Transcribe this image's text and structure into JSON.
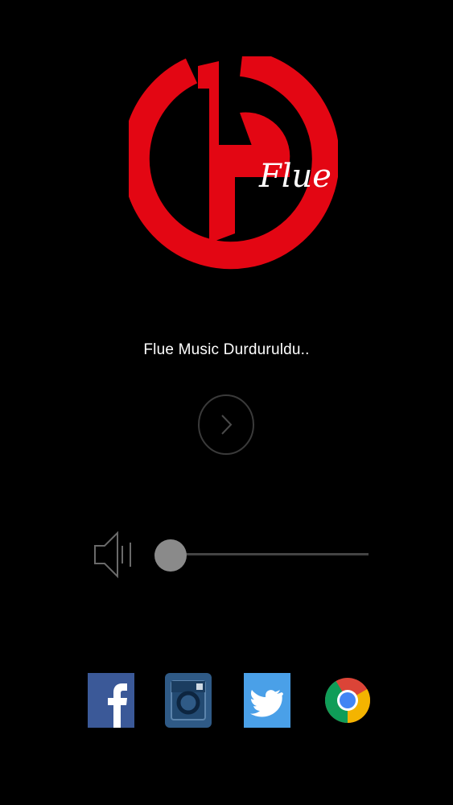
{
  "logo": {
    "text": "Flue",
    "brand_color": "#e30613",
    "icon": "flue-logo"
  },
  "player": {
    "status_text": "Flue Music Durduruldu..",
    "play_icon": "chevron-right-icon"
  },
  "volume": {
    "icon": "speaker-icon",
    "level": 0.0
  },
  "social": [
    {
      "name": "facebook",
      "icon": "facebook-icon",
      "color": "#3b5998"
    },
    {
      "name": "instagram",
      "icon": "instagram-icon",
      "color": "#2f5a86"
    },
    {
      "name": "twitter",
      "icon": "twitter-icon",
      "color": "#4aa0e8"
    },
    {
      "name": "chrome",
      "icon": "chrome-icon",
      "color": "#db4437"
    }
  ]
}
